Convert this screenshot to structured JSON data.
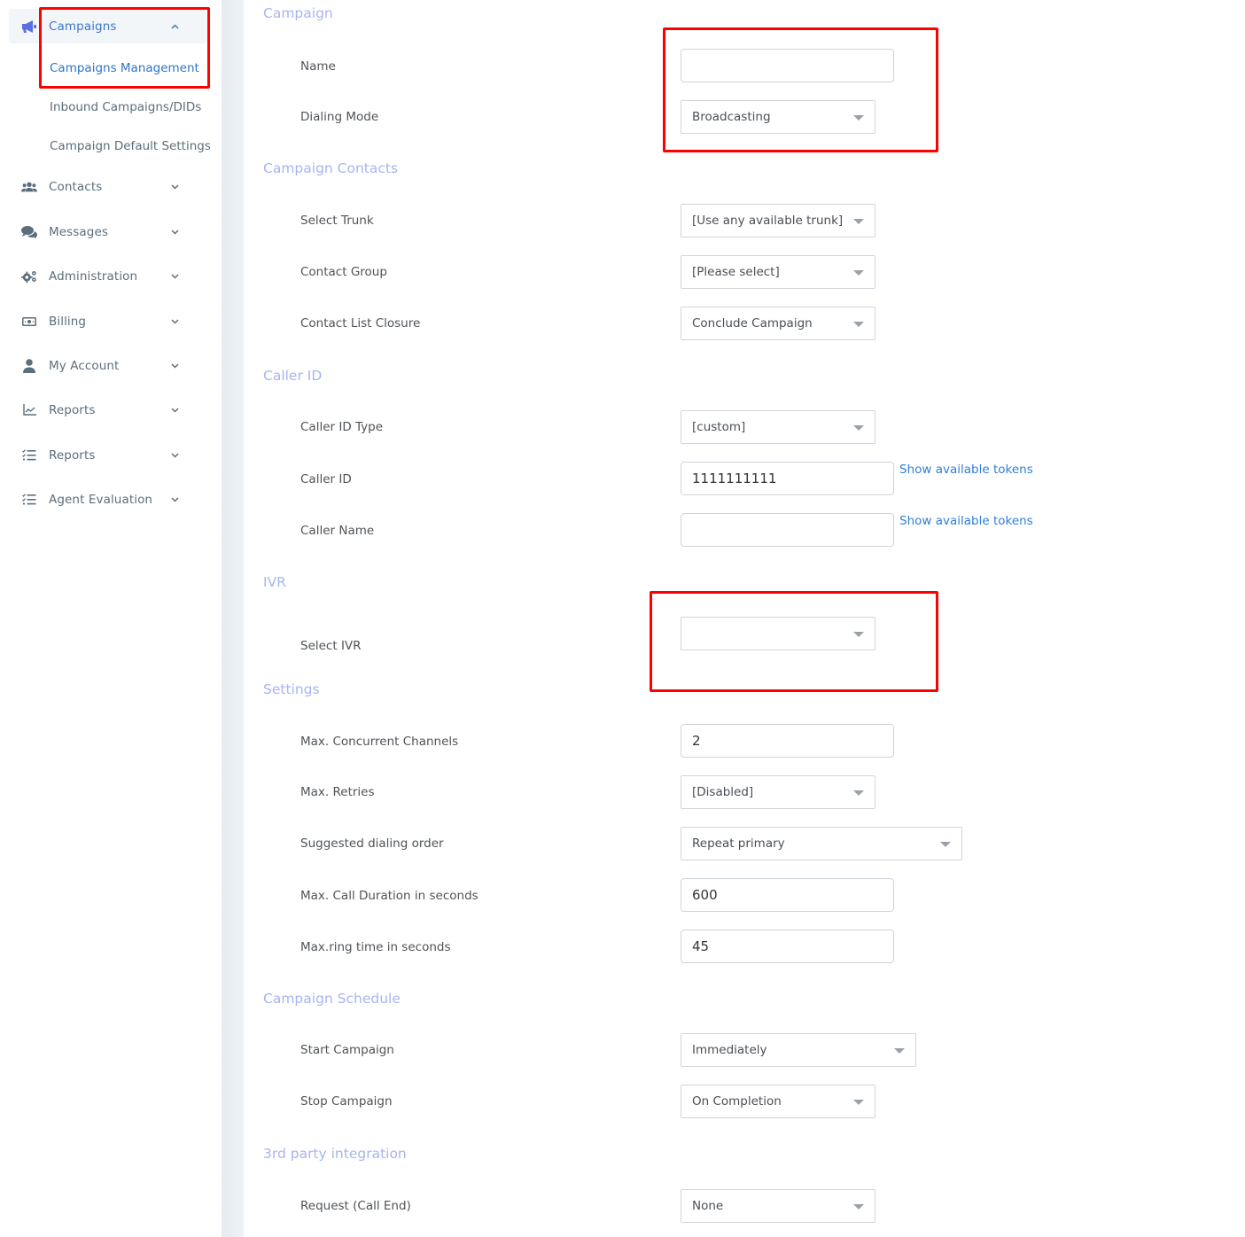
{
  "sidebar": {
    "items": [
      {
        "label": "Campaigns",
        "icon": "megaphone-icon",
        "expanded": true
      },
      {
        "label": "Contacts",
        "icon": "users-icon"
      },
      {
        "label": "Messages",
        "icon": "comments-icon"
      },
      {
        "label": "Administration",
        "icon": "gears-icon"
      },
      {
        "label": "Billing",
        "icon": "money-bill-icon"
      },
      {
        "label": "My Account",
        "icon": "user-icon"
      },
      {
        "label": "Reports",
        "icon": "chart-line-icon"
      },
      {
        "label": "Reports",
        "icon": "tasks-list-icon"
      },
      {
        "label": "Agent Evaluation",
        "icon": "tasks-list-icon"
      }
    ],
    "campaigns_submenu": [
      {
        "label": "Campaigns Management",
        "active": true
      },
      {
        "label": "Inbound Campaigns/DIDs"
      },
      {
        "label": "Campaign Default Settings"
      }
    ]
  },
  "form": {
    "sections": {
      "campaign": "Campaign",
      "contacts": "Campaign Contacts",
      "caller_id": "Caller ID",
      "ivr": "IVR",
      "settings": "Settings",
      "schedule": "Campaign Schedule",
      "integration": "3rd party integration"
    },
    "fields": {
      "name": {
        "label": "Name",
        "value": ""
      },
      "dialing_mode": {
        "label": "Dialing Mode",
        "value": "Broadcasting"
      },
      "select_trunk": {
        "label": "Select Trunk",
        "value": "[Use any available trunk]"
      },
      "contact_group": {
        "label": "Contact Group",
        "value": "[Please select]"
      },
      "contact_list_closure": {
        "label": "Contact List Closure",
        "value": "Conclude Campaign"
      },
      "caller_id_type": {
        "label": "Caller ID Type",
        "value": "[custom]"
      },
      "caller_id": {
        "label": "Caller ID",
        "value": "1111111111"
      },
      "caller_name": {
        "label": "Caller Name",
        "value": ""
      },
      "select_ivr": {
        "label": "Select IVR",
        "value": ""
      },
      "max_channels": {
        "label": "Max. Concurrent Channels",
        "value": "2"
      },
      "max_retries": {
        "label": "Max. Retries",
        "value": "[Disabled]"
      },
      "dialing_order": {
        "label": "Suggested dialing order",
        "value": "Repeat primary"
      },
      "max_duration": {
        "label": "Max. Call Duration in seconds",
        "value": "600"
      },
      "max_ring": {
        "label": "Max.ring time in seconds",
        "value": "45"
      },
      "start_campaign": {
        "label": "Start Campaign",
        "value": "Immediately"
      },
      "stop_campaign": {
        "label": "Stop Campaign",
        "value": "On Completion"
      },
      "request_call_end": {
        "label": "Request (Call End)",
        "value": "None"
      }
    },
    "token_link": "Show available tokens"
  },
  "colors": {
    "accent": "#3a78c9",
    "section_title": "#a7b5f0",
    "link": "#2f7fd8",
    "annotation": "#ff0000"
  }
}
